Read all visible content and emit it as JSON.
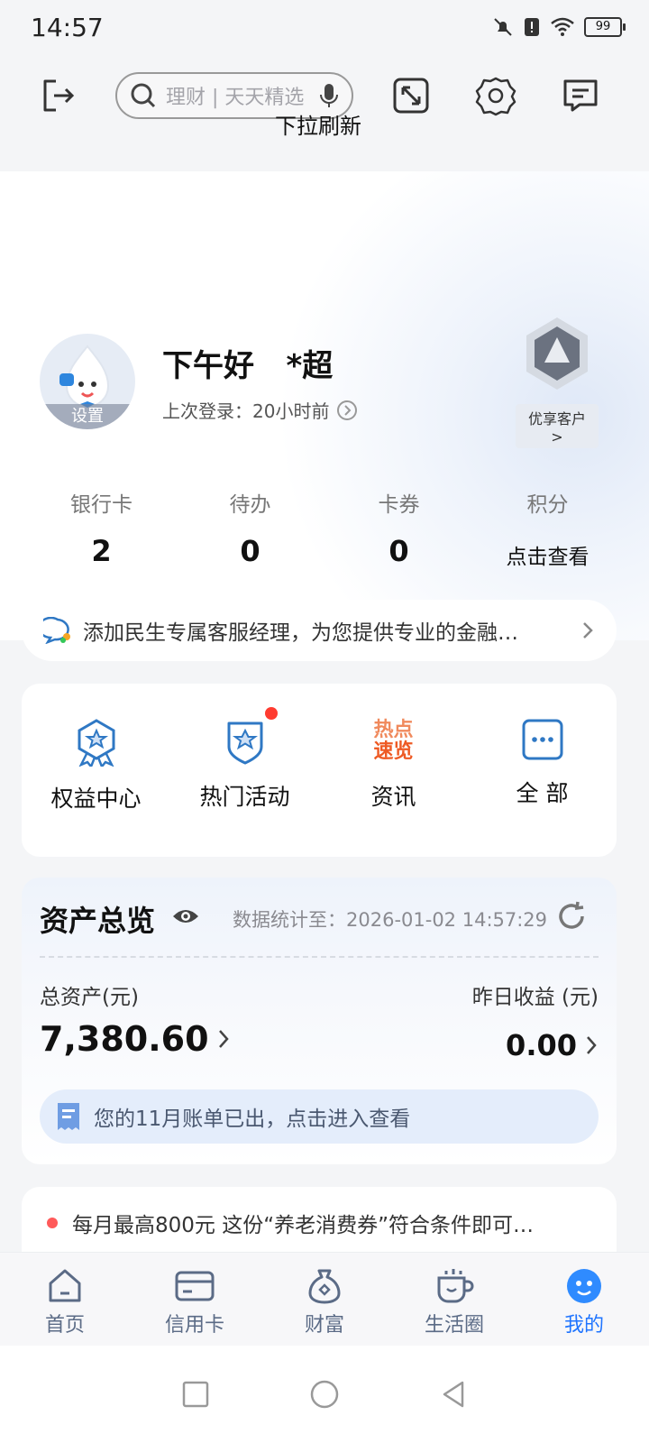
{
  "status_bar": {
    "time": "14:57",
    "battery": "99"
  },
  "header": {
    "search_placeholder": "理财 | 天天精选",
    "pull_hint": "下拉刷新"
  },
  "profile": {
    "avatar_label": "设置",
    "greeting": "下午好",
    "name": "*超",
    "last_login": "上次登录：20小时前",
    "level_badge": "优享客户 >"
  },
  "stats": [
    {
      "label": "银行卡",
      "value": "2"
    },
    {
      "label": "待办",
      "value": "0"
    },
    {
      "label": "卡券",
      "value": "0"
    },
    {
      "label": "积分",
      "value": "点击查看"
    }
  ],
  "notice": {
    "text": "添加民生专属客服经理，为您提供专业的金融…"
  },
  "shortcuts": [
    {
      "label": "权益中心"
    },
    {
      "label": "热门活动"
    },
    {
      "label": "资讯",
      "icon_text_1": "热点",
      "icon_text_2": "速览"
    },
    {
      "label": "全 部"
    }
  ],
  "assets": {
    "title": "资产总览",
    "updated": "数据统计至：2026-01-02 14:57:29",
    "total_label": "总资产(元)",
    "total_value": "7,380.60",
    "yesterday_label": "昨日收益 (元)",
    "yesterday_value": "0.00",
    "bill_notice": "您的11月账单已出，点击进入查看"
  },
  "news": {
    "text": "每月最高800元 这份“养老消费券”符合条件即可…"
  },
  "tabs": [
    {
      "label": "首页"
    },
    {
      "label": "信用卡"
    },
    {
      "label": "财富"
    },
    {
      "label": "生活圈"
    },
    {
      "label": "我的"
    }
  ],
  "colors": {
    "accent": "#1f74ff",
    "icon_blue": "#2f78c4",
    "hot_orange": "#ee6b2f",
    "red_dot": "#ff3b30"
  }
}
